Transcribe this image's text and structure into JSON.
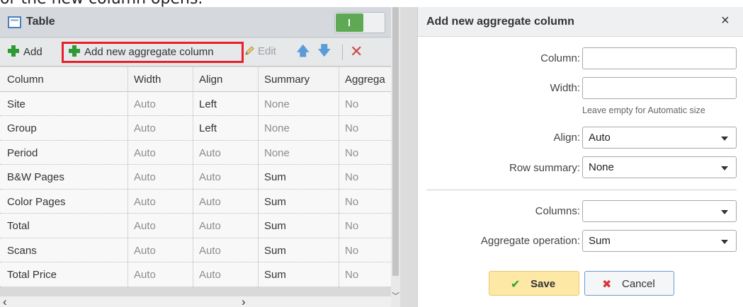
{
  "caption": "or the new column opens.",
  "left_panel": {
    "title": "Table",
    "toolbar": {
      "add_label": "Add",
      "add_aggregate_label": "Add new aggregate column",
      "edit_label": "Edit"
    },
    "columns": [
      "Column",
      "Width",
      "Align",
      "Summary",
      "Aggrega"
    ],
    "rows": [
      [
        "Site",
        "Auto",
        "Left",
        "None",
        "No"
      ],
      [
        "Group",
        "Auto",
        "Left",
        "None",
        "No"
      ],
      [
        "Period",
        "Auto",
        "Auto",
        "None",
        "No"
      ],
      [
        "B&W Pages",
        "Auto",
        "Auto",
        "Sum",
        "No"
      ],
      [
        "Color Pages",
        "Auto",
        "Auto",
        "Sum",
        "No"
      ],
      [
        "Total",
        "Auto",
        "Auto",
        "Sum",
        "No"
      ],
      [
        "Scans",
        "Auto",
        "Auto",
        "Sum",
        "No"
      ],
      [
        "Total Price",
        "Auto",
        "Auto",
        "Sum",
        "No"
      ]
    ]
  },
  "dialog": {
    "title": "Add new aggregate column",
    "close_glyph": "×",
    "fields": {
      "column_label": "Column:",
      "column_value": "",
      "width_label": "Width:",
      "width_value": "",
      "width_hint": "Leave empty for Automatic size",
      "align_label": "Align:",
      "align_value": "Auto",
      "row_summary_label": "Row summary:",
      "row_summary_value": "None",
      "columns_label": "Columns:",
      "columns_value": "",
      "aggregate_label": "Aggregate operation:",
      "aggregate_value": "Sum"
    },
    "buttons": {
      "save_label": "Save",
      "cancel_label": "Cancel"
    }
  },
  "colors": {
    "highlight": "#e8202a",
    "toggle_on": "#5fa854",
    "add_green": "#2e9a34",
    "save_bg": "#fde8a6",
    "cancel_border": "#6e9ccc"
  }
}
